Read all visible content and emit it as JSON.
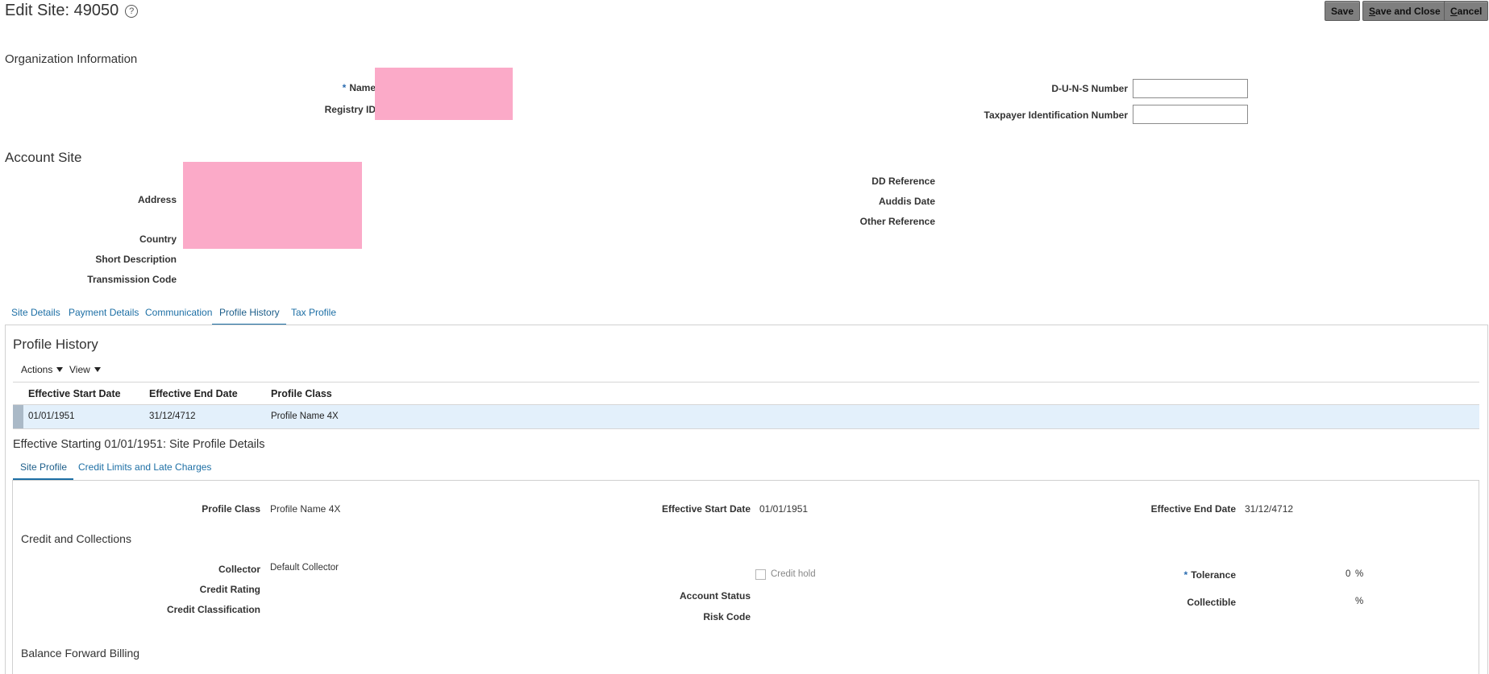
{
  "header": {
    "title": "Edit Site: 49050",
    "help_glyph": "?",
    "buttons": {
      "save_label": "Save",
      "save_close_mnemonic": "S",
      "save_close_rest": "ave and Close",
      "cancel_mnemonic": "C",
      "cancel_rest": "ancel"
    }
  },
  "organization": {
    "heading": "Organization Information",
    "required_mark": "*",
    "name_label": "Name",
    "registry_label": "Registry ID",
    "duns_label": "D-U-N-S Number",
    "duns_value": "",
    "taxpayer_label": "Taxpayer Identification Number",
    "taxpayer_value": ""
  },
  "account_site": {
    "heading": "Account Site",
    "address_label": "Address",
    "country_label": "Country",
    "short_desc_label": "Short Description",
    "transmission_label": "Transmission Code",
    "dd_reference_label": "DD Reference",
    "auddis_label": "Auddis Date",
    "other_reference_label": "Other Reference"
  },
  "tabs": [
    {
      "label": "Site Details"
    },
    {
      "label": "Payment Details"
    },
    {
      "label": "Communication"
    },
    {
      "label": "Profile History",
      "active": true
    },
    {
      "label": "Tax Profile"
    }
  ],
  "profile_history": {
    "heading": "Profile History",
    "toolbar": {
      "actions": "Actions",
      "view": "View"
    },
    "columns": [
      "Effective Start Date",
      "Effective End Date",
      "Profile Class"
    ],
    "rows": [
      {
        "start": "01/01/1951",
        "end": "31/12/4712",
        "profile_class": "Profile Name 4X"
      }
    ]
  },
  "details": {
    "heading": "Effective Starting 01/01/1951: Site Profile Details",
    "subtabs": [
      {
        "label": "Site Profile",
        "active": true
      },
      {
        "label": "Credit Limits and Late Charges"
      }
    ],
    "profile_class_label": "Profile Class",
    "profile_class_value": "Profile Name 4X",
    "eff_start_label": "Effective Start Date",
    "eff_start_value": "01/01/1951",
    "eff_end_label": "Effective End Date",
    "eff_end_value": "31/12/4712",
    "credit_heading": "Credit and Collections",
    "collector_label": "Collector",
    "collector_value": "Default Collector",
    "credit_rating_label": "Credit Rating",
    "credit_class_label": "Credit Classification",
    "credit_hold_label": "Credit hold",
    "account_status_label": "Account Status",
    "risk_code_label": "Risk Code",
    "tolerance_label": "Tolerance",
    "tolerance_value": "0",
    "percent": "%",
    "collectible_label": "Collectible",
    "collectible_value": "",
    "balance_heading": "Balance Forward Billing"
  },
  "colors": {
    "accent": "#1d6fa5",
    "redaction": "#fbaac8",
    "selected_row": "#e3f0fb",
    "button_bg": "#7f7f7f"
  }
}
